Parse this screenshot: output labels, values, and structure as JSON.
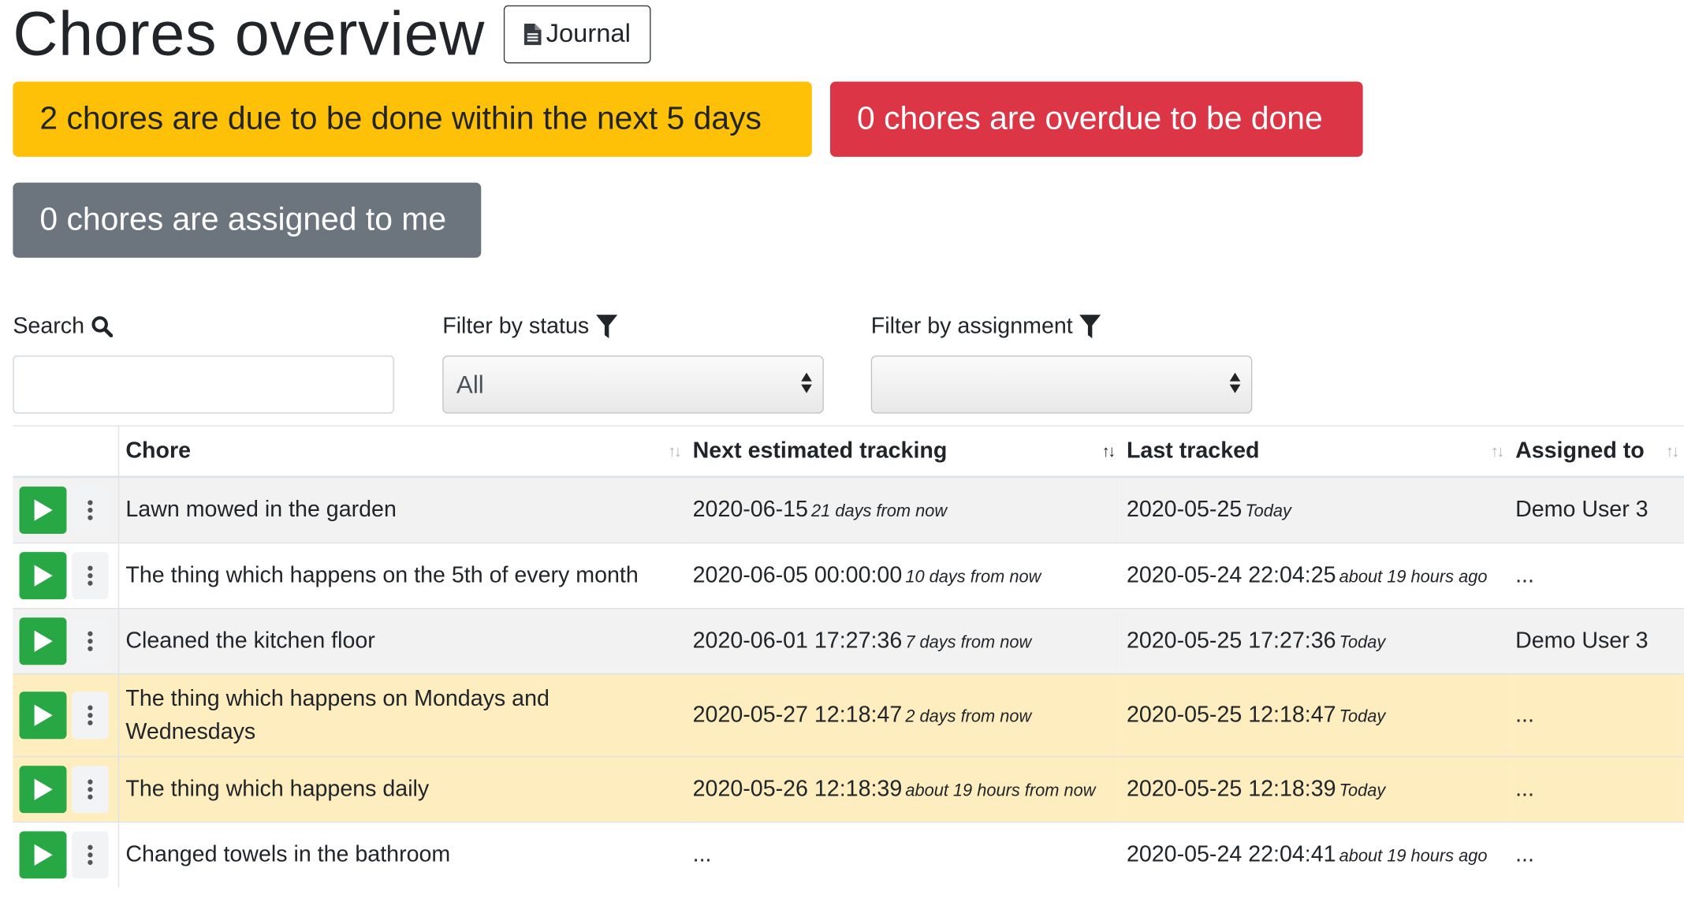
{
  "header": {
    "title": "Chores overview",
    "journal_label": "Journal"
  },
  "status_badges": {
    "due": "2 chores are due to be done within the next 5 days",
    "overdue": "0 chores are overdue to be done",
    "assigned": "0 chores are assigned to me",
    "colors": {
      "due": "#ffc107",
      "overdue": "#dc3545",
      "assigned": "#6c757d"
    }
  },
  "filters": {
    "search_label": "Search",
    "search_value": "",
    "status_label": "Filter by status",
    "status_value": "All",
    "assignment_label": "Filter by assignment",
    "assignment_value": ""
  },
  "table": {
    "columns": [
      "Chore",
      "Next estimated tracking",
      "Last tracked",
      "Assigned to"
    ],
    "rows": [
      {
        "chore": "Lawn mowed in the garden",
        "next": "2020-06-15",
        "next_rel": "21 days from now",
        "last": "2020-05-25",
        "last_rel": "Today",
        "assigned": "Demo User 3"
      },
      {
        "chore": "The thing which happens on the 5th of every month",
        "next": "2020-06-05 00:00:00",
        "next_rel": "10 days from now",
        "last": "2020-05-24 22:04:25",
        "last_rel": "about 19 hours ago",
        "assigned": "..."
      },
      {
        "chore": "Cleaned the kitchen floor",
        "next": "2020-06-01 17:27:36",
        "next_rel": "7 days from now",
        "last": "2020-05-25 17:27:36",
        "last_rel": "Today",
        "assigned": "Demo User 3"
      },
      {
        "chore": "The thing which happens on Mondays and Wednesdays",
        "next": "2020-05-27 12:18:47",
        "next_rel": "2 days from now",
        "last": "2020-05-25 12:18:47",
        "last_rel": "Today",
        "assigned": "..."
      },
      {
        "chore": "The thing which happens daily",
        "next": "2020-05-26 12:18:39",
        "next_rel": "about 19 hours from now",
        "last": "2020-05-25 12:18:39",
        "last_rel": "Today",
        "assigned": "..."
      },
      {
        "chore": "Changed towels in the bathroom",
        "next": "...",
        "next_rel": "",
        "last": "2020-05-24 22:04:41",
        "last_rel": "about 19 hours ago",
        "assigned": "..."
      }
    ]
  },
  "icons": {
    "journal": "file-text-icon",
    "search": "search-icon",
    "filter": "filter-icon",
    "track": "play-icon",
    "more": "vertical-ellipsis-icon",
    "sort": "sort-icon"
  },
  "colors": {
    "track_button": "#28a745",
    "row_warning": "#fdedbf",
    "row_striped": "#f2f2f2"
  }
}
